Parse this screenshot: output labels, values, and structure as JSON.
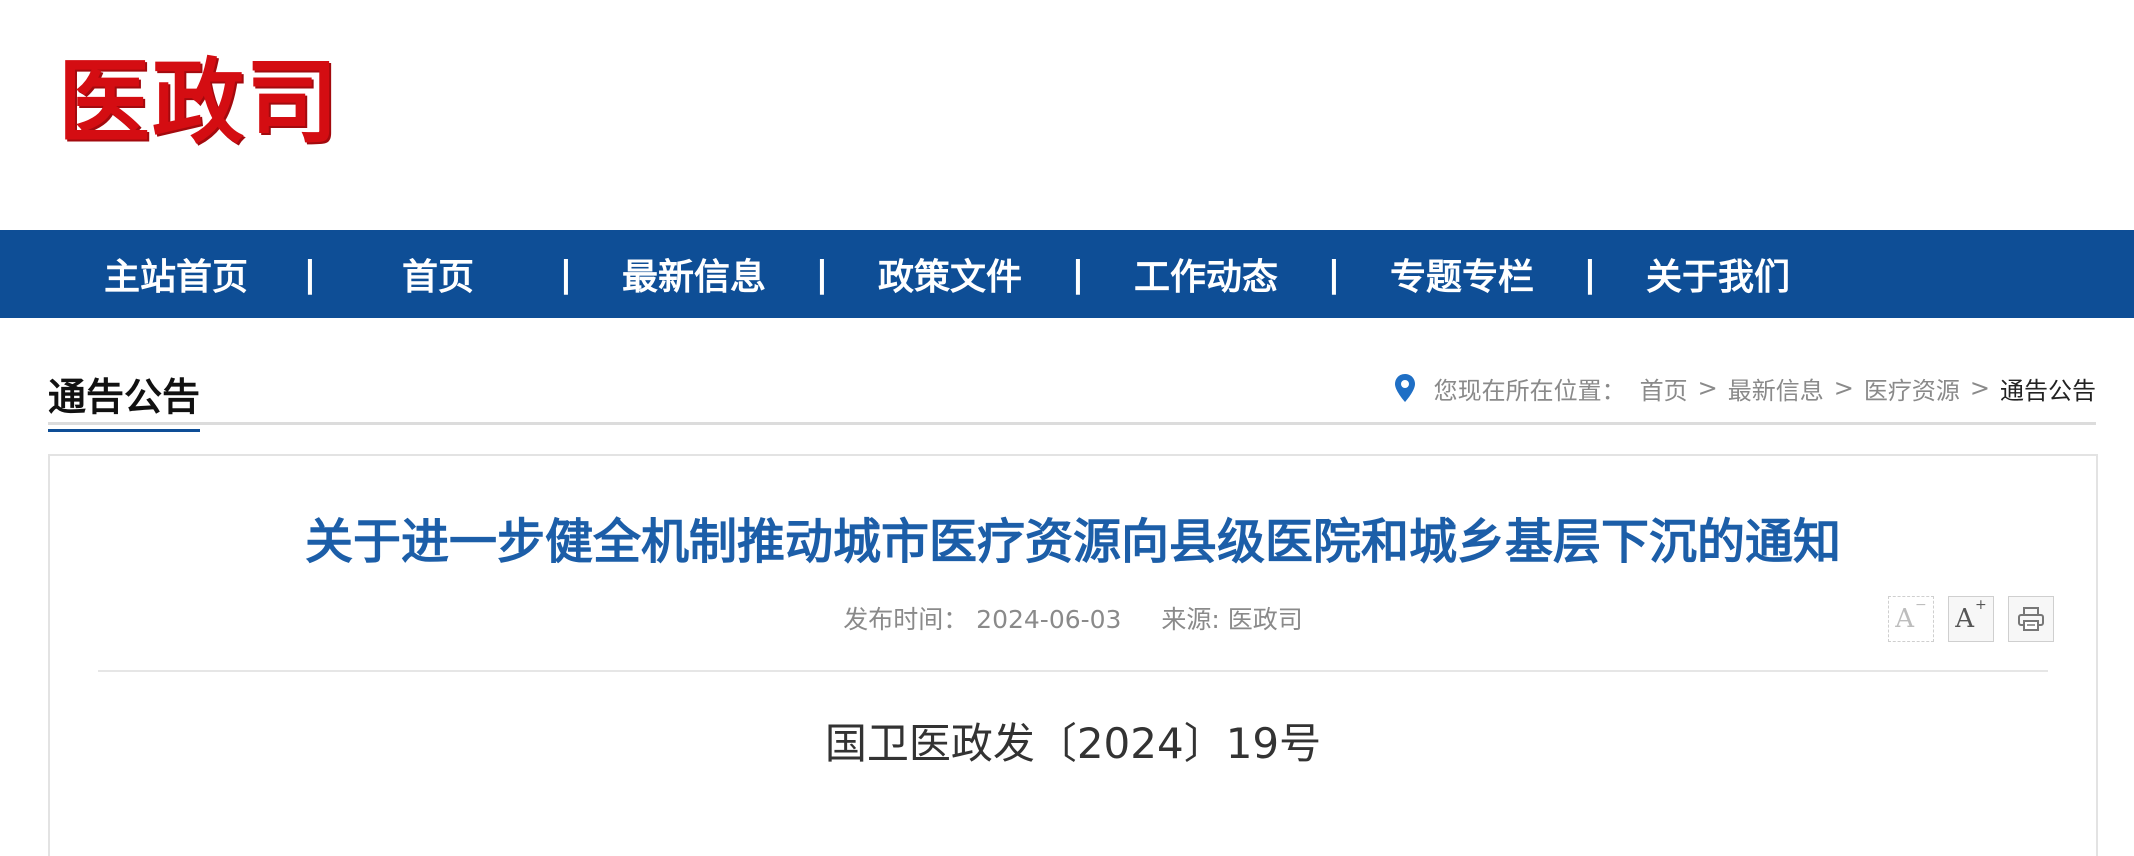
{
  "site": {
    "logo_text": "医政司",
    "brand_color": "#d40d12"
  },
  "nav": {
    "background": "#0e4e96",
    "items": [
      {
        "label": "主站首页"
      },
      {
        "label": "首页"
      },
      {
        "label": "最新信息"
      },
      {
        "label": "政策文件"
      },
      {
        "label": "工作动态"
      },
      {
        "label": "专题专栏"
      },
      {
        "label": "关于我们"
      }
    ],
    "separator": "|"
  },
  "section": {
    "title": "通告公告",
    "breadcrumb": {
      "icon": "location-pin-icon",
      "label": "您现在所在位置：",
      "items": [
        "首页",
        "最新信息",
        "医疗资源",
        "通告公告"
      ],
      "separator": ">"
    }
  },
  "article": {
    "title": "关于进一步健全机制推动城市医疗资源向县级医院和城乡基层下沉的通知",
    "title_color": "#1c5ea8",
    "publish_label": "发布时间：",
    "publish_date": "2024-06-03",
    "source_label": "来源:",
    "source": "医政司",
    "doc_number": "国卫医政发〔2024〕19号"
  },
  "tools": {
    "decrease_font": {
      "icon": "font-decrease-icon",
      "glyph": "A",
      "mark": "−"
    },
    "increase_font": {
      "icon": "font-increase-icon",
      "glyph": "A",
      "mark": "+"
    },
    "print": {
      "icon": "printer-icon"
    }
  }
}
